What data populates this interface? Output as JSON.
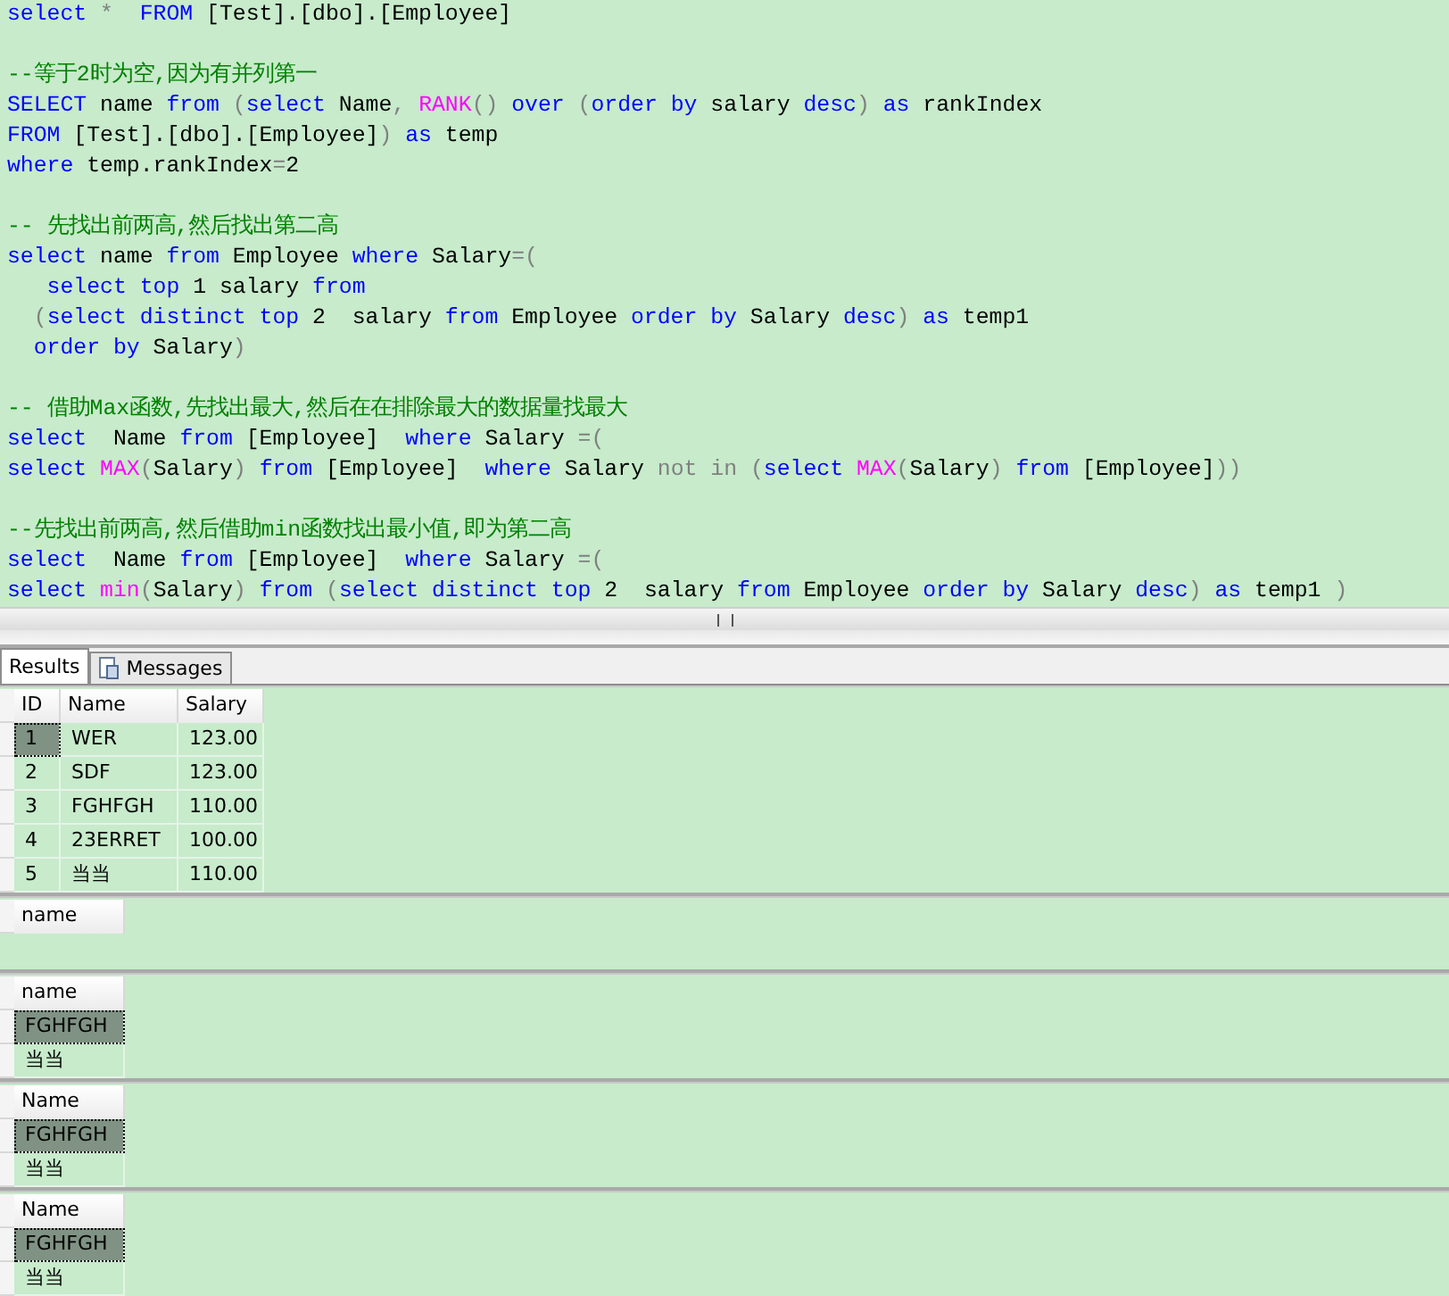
{
  "editor": {
    "blocks": [
      [
        [
          {
            "kind": "keyword",
            "t": "select"
          },
          {
            "kind": "operator",
            "t": " *  "
          },
          {
            "kind": "keyword",
            "t": "FROM"
          },
          {
            "kind": "plain",
            "t": " [Test].[dbo].[Employee]"
          }
        ]
      ],
      [
        [
          {
            "kind": "comment",
            "t": "--等于2时为空,因为有并列第一"
          }
        ],
        [
          {
            "kind": "keyword",
            "t": "SELECT"
          },
          {
            "kind": "plain",
            "t": " name "
          },
          {
            "kind": "keyword",
            "t": "from"
          },
          {
            "kind": "operator",
            "t": " ("
          },
          {
            "kind": "keyword",
            "t": "select"
          },
          {
            "kind": "plain",
            "t": " Name"
          },
          {
            "kind": "operator",
            "t": ", "
          },
          {
            "kind": "function",
            "t": "RANK"
          },
          {
            "kind": "operator",
            "t": "() "
          },
          {
            "kind": "keyword",
            "t": "over"
          },
          {
            "kind": "operator",
            "t": " ("
          },
          {
            "kind": "keyword",
            "t": "order by"
          },
          {
            "kind": "plain",
            "t": " salary "
          },
          {
            "kind": "keyword",
            "t": "desc"
          },
          {
            "kind": "operator",
            "t": ") "
          },
          {
            "kind": "keyword",
            "t": "as"
          },
          {
            "kind": "plain",
            "t": " rankIndex"
          }
        ],
        [
          {
            "kind": "keyword",
            "t": "FROM"
          },
          {
            "kind": "plain",
            "t": " [Test].[dbo].[Employee]"
          },
          {
            "kind": "operator",
            "t": ") "
          },
          {
            "kind": "keyword",
            "t": "as"
          },
          {
            "kind": "plain",
            "t": " temp"
          }
        ],
        [
          {
            "kind": "keyword",
            "t": "where"
          },
          {
            "kind": "plain",
            "t": " temp.rankIndex"
          },
          {
            "kind": "operator",
            "t": "="
          },
          {
            "kind": "plain",
            "t": "2"
          }
        ]
      ],
      [
        [
          {
            "kind": "comment",
            "t": "-- 先找出前两高,然后找出第二高"
          }
        ],
        [
          {
            "kind": "keyword",
            "t": "select"
          },
          {
            "kind": "plain",
            "t": " name "
          },
          {
            "kind": "keyword",
            "t": "from"
          },
          {
            "kind": "plain",
            "t": " Employee "
          },
          {
            "kind": "keyword",
            "t": "where"
          },
          {
            "kind": "plain",
            "t": " Salary"
          },
          {
            "kind": "operator",
            "t": "=("
          }
        ],
        [
          {
            "kind": "keyword",
            "t": "   select top"
          },
          {
            "kind": "plain",
            "t": " 1 salary "
          },
          {
            "kind": "keyword",
            "t": "from"
          }
        ],
        [
          {
            "kind": "operator",
            "t": "  ("
          },
          {
            "kind": "keyword",
            "t": "select distinct top"
          },
          {
            "kind": "plain",
            "t": " 2  salary "
          },
          {
            "kind": "keyword",
            "t": "from"
          },
          {
            "kind": "plain",
            "t": " Employee "
          },
          {
            "kind": "keyword",
            "t": "order by"
          },
          {
            "kind": "plain",
            "t": " Salary "
          },
          {
            "kind": "keyword",
            "t": "desc"
          },
          {
            "kind": "operator",
            "t": ") "
          },
          {
            "kind": "keyword",
            "t": "as"
          },
          {
            "kind": "plain",
            "t": " temp1"
          }
        ],
        [
          {
            "kind": "keyword",
            "t": "  order by"
          },
          {
            "kind": "plain",
            "t": " Salary"
          },
          {
            "kind": "operator",
            "t": ")"
          }
        ]
      ],
      [
        [
          {
            "kind": "comment",
            "t": "-- 借助Max函数,先找出最大,然后在在排除最大的数据量找最大"
          }
        ],
        [
          {
            "kind": "keyword",
            "t": "select"
          },
          {
            "kind": "plain",
            "t": "  Name "
          },
          {
            "kind": "keyword",
            "t": "from"
          },
          {
            "kind": "plain",
            "t": " [Employee]  "
          },
          {
            "kind": "keyword",
            "t": "where"
          },
          {
            "kind": "plain",
            "t": " Salary "
          },
          {
            "kind": "operator",
            "t": "=("
          }
        ],
        [
          {
            "kind": "keyword",
            "t": "select"
          },
          {
            "kind": "function",
            "t": " MAX"
          },
          {
            "kind": "operator",
            "t": "("
          },
          {
            "kind": "plain",
            "t": "Salary"
          },
          {
            "kind": "operator",
            "t": ") "
          },
          {
            "kind": "keyword",
            "t": "from"
          },
          {
            "kind": "plain",
            "t": " [Employee]  "
          },
          {
            "kind": "keyword",
            "t": "where"
          },
          {
            "kind": "plain",
            "t": " Salary "
          },
          {
            "kind": "operator",
            "t": "not in ("
          },
          {
            "kind": "keyword",
            "t": "select"
          },
          {
            "kind": "function",
            "t": " MAX"
          },
          {
            "kind": "operator",
            "t": "("
          },
          {
            "kind": "plain",
            "t": "Salary"
          },
          {
            "kind": "operator",
            "t": ") "
          },
          {
            "kind": "keyword",
            "t": "from"
          },
          {
            "kind": "plain",
            "t": " [Employee]"
          },
          {
            "kind": "operator",
            "t": "))"
          }
        ]
      ],
      [
        [
          {
            "kind": "comment",
            "t": "--先找出前两高,然后借助min函数找出最小值,即为第二高"
          }
        ],
        [
          {
            "kind": "keyword",
            "t": "select"
          },
          {
            "kind": "plain",
            "t": "  Name "
          },
          {
            "kind": "keyword",
            "t": "from"
          },
          {
            "kind": "plain",
            "t": " [Employee]  "
          },
          {
            "kind": "keyword",
            "t": "where"
          },
          {
            "kind": "plain",
            "t": " Salary "
          },
          {
            "kind": "operator",
            "t": "=("
          }
        ],
        [
          {
            "kind": "keyword",
            "t": "select"
          },
          {
            "kind": "function",
            "t": " min"
          },
          {
            "kind": "operator",
            "t": "("
          },
          {
            "kind": "plain",
            "t": "Salary"
          },
          {
            "kind": "operator",
            "t": ") "
          },
          {
            "kind": "keyword",
            "t": "from"
          },
          {
            "kind": "operator",
            "t": " ("
          },
          {
            "kind": "keyword",
            "t": "select distinct top"
          },
          {
            "kind": "plain",
            "t": " 2  salary "
          },
          {
            "kind": "keyword",
            "t": "from"
          },
          {
            "kind": "plain",
            "t": " Employee "
          },
          {
            "kind": "keyword",
            "t": "order by"
          },
          {
            "kind": "plain",
            "t": " Salary "
          },
          {
            "kind": "keyword",
            "t": "desc"
          },
          {
            "kind": "operator",
            "t": ") "
          },
          {
            "kind": "keyword",
            "t": "as"
          },
          {
            "kind": "plain",
            "t": " temp1 "
          },
          {
            "kind": "operator",
            "t": ")"
          }
        ]
      ]
    ]
  },
  "tabs": [
    {
      "label": "Results",
      "selected": true
    },
    {
      "label": "Messages",
      "selected": false
    }
  ],
  "grids": [
    {
      "columns": [
        "ID",
        "Name",
        "Salary"
      ],
      "rows": [
        {
          "cells": [
            "1",
            "WER",
            "123.00"
          ],
          "selected": true
        },
        {
          "cells": [
            "2",
            "SDF",
            "123.00"
          ],
          "selected": false
        },
        {
          "cells": [
            "3",
            "FGHFGH",
            "110.00"
          ],
          "selected": false
        },
        {
          "cells": [
            "4",
            "23ERRET",
            "100.00"
          ],
          "selected": false
        },
        {
          "cells": [
            "5",
            "当当",
            "110.00"
          ],
          "selected": false
        }
      ]
    },
    {
      "columns": [
        "name"
      ]
    },
    {
      "columns": [
        "name"
      ],
      "rows": [
        {
          "cells": [
            "FGHFGH"
          ],
          "selected": true
        },
        {
          "cells": [
            "当当"
          ],
          "selected": false
        }
      ]
    },
    {
      "columns": [
        "Name"
      ],
      "rows": [
        {
          "cells": [
            "FGHFGH"
          ],
          "selected": true
        },
        {
          "cells": [
            "当当"
          ],
          "selected": false
        }
      ]
    },
    {
      "columns": [
        "Name"
      ],
      "rows": [
        {
          "cells": [
            "FGHFGH"
          ],
          "selected": true
        },
        {
          "cells": [
            "当当"
          ],
          "selected": false
        }
      ]
    }
  ]
}
